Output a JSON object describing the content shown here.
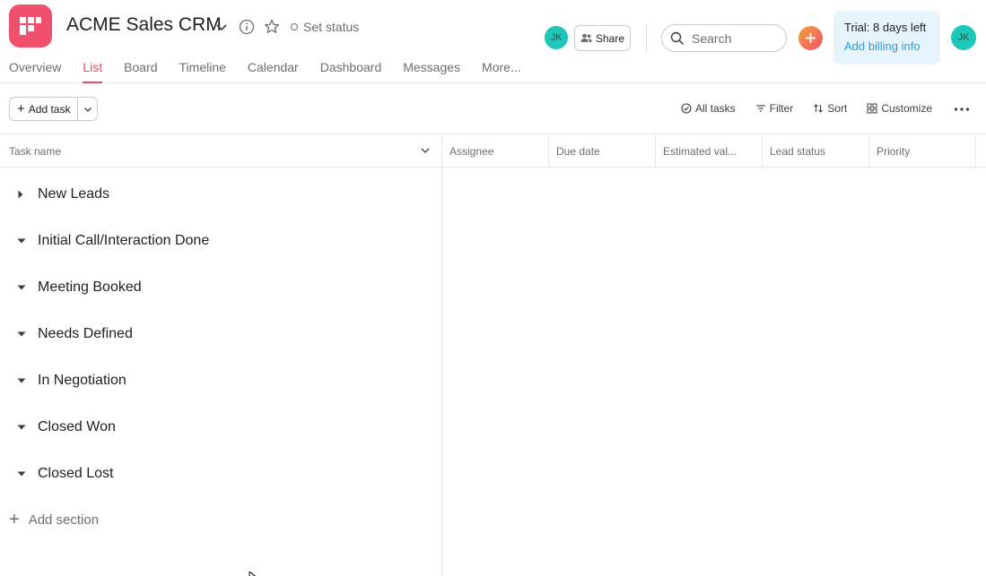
{
  "header": {
    "project_title": "ACME Sales CRM",
    "set_status_label": "Set status",
    "member_avatar_initials": "JK",
    "share_label": "Share",
    "search_placeholder": "Search",
    "trial_text": "Trial: 8 days left",
    "billing_link": "Add billing info",
    "user_avatar_initials": "JK",
    "brand_color": "#f0506e",
    "avatar_color": "#1ec8b8"
  },
  "tabs": [
    {
      "label": "Overview",
      "active": false
    },
    {
      "label": "List",
      "active": true
    },
    {
      "label": "Board",
      "active": false
    },
    {
      "label": "Timeline",
      "active": false
    },
    {
      "label": "Calendar",
      "active": false
    },
    {
      "label": "Dashboard",
      "active": false
    },
    {
      "label": "Messages",
      "active": false
    },
    {
      "label": "More...",
      "active": false
    }
  ],
  "toolbar": {
    "add_task_label": "Add task",
    "all_tasks_label": "All tasks",
    "filter_label": "Filter",
    "sort_label": "Sort",
    "customize_label": "Customize"
  },
  "columns": {
    "task_name": "Task name",
    "assignee": "Assignee",
    "due_date": "Due date",
    "estimated_value": "Estimated val...",
    "lead_status": "Lead status",
    "priority": "Priority"
  },
  "sections": [
    {
      "title": "New Leads",
      "expanded": false
    },
    {
      "title": "Initial Call/Interaction Done",
      "expanded": true
    },
    {
      "title": "Meeting Booked",
      "expanded": true
    },
    {
      "title": "Needs Defined",
      "expanded": true
    },
    {
      "title": "In Negotiation",
      "expanded": true
    },
    {
      "title": "Closed Won",
      "expanded": true
    },
    {
      "title": "Closed Lost",
      "expanded": true
    }
  ],
  "add_section_label": "Add section"
}
